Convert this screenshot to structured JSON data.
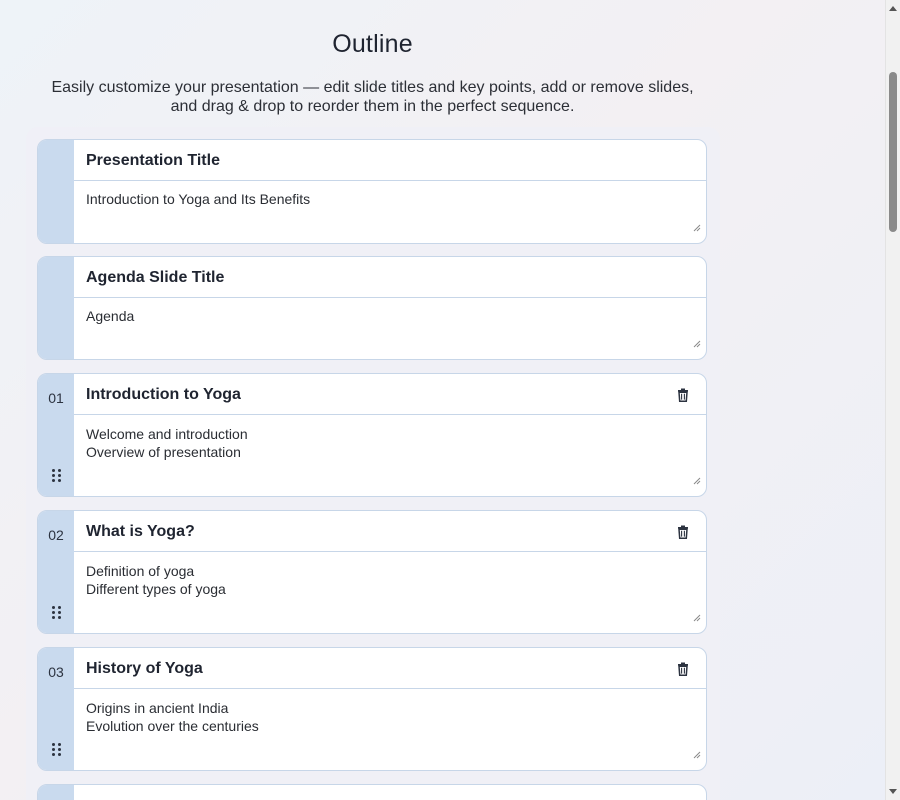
{
  "header": {
    "title": "Outline",
    "subtitle": "Easily customize your presentation — edit slide titles and key points, add or remove slides, and drag & drop to reorder them in the perfect sequence."
  },
  "fixed_cards": [
    {
      "heading": "Presentation Title",
      "body": "Introduction to Yoga and Its Benefits"
    },
    {
      "heading": "Agenda Slide Title",
      "body": "Agenda"
    }
  ],
  "slides": [
    {
      "number": "01",
      "title": "Introduction to Yoga",
      "points": "Welcome and introduction\nOverview of presentation"
    },
    {
      "number": "02",
      "title": "What is Yoga?",
      "points": "Definition of yoga\nDifferent types of yoga"
    },
    {
      "number": "03",
      "title": "History of Yoga",
      "points": "Origins in ancient India\nEvolution over the centuries"
    }
  ],
  "icons": {
    "delete": "trash-icon",
    "reorder": "drag-handle-icon"
  },
  "colors": {
    "gutter": "#c9daee",
    "border": "#c7d6e8",
    "text": "#1f2430"
  }
}
